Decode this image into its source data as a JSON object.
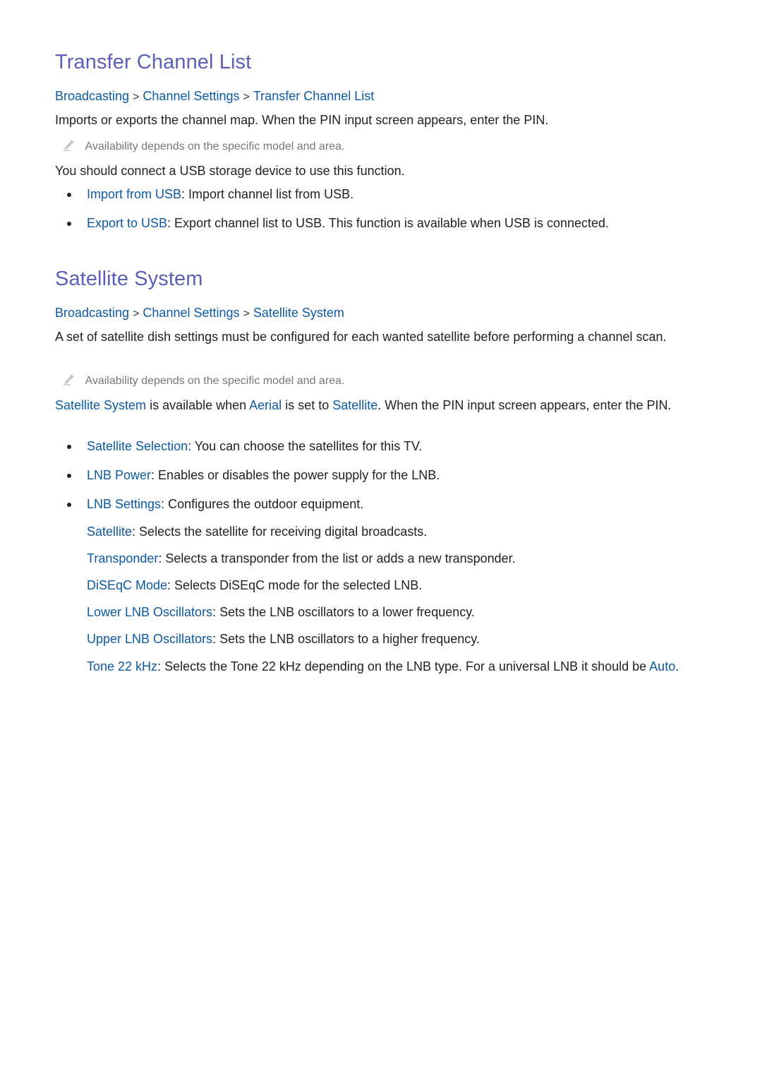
{
  "colors": {
    "heading": "#5b5fb5",
    "link": "#0b5aa2",
    "text": "#222222",
    "note": "#777777"
  },
  "sections": [
    {
      "title": "Transfer Channel List",
      "breadcrumb": [
        "Broadcasting",
        "Channel Settings",
        "Transfer Channel List"
      ],
      "breadcrumb_separator": ">",
      "description": "Imports or exports the channel map. When the PIN input screen appears, enter the PIN.",
      "note": "Availability depends on the specific model and area.",
      "note_icon": "pencil-icon",
      "requirement": "You should connect a USB storage device to use this function.",
      "items": [
        {
          "term": "Import from USB",
          "text": ": Import channel list from USB."
        },
        {
          "term": "Export to USB",
          "text": ": Export channel list to USB. This function is available when USB is connected."
        }
      ]
    },
    {
      "title": "Satellite System",
      "breadcrumb": [
        "Broadcasting",
        "Channel Settings",
        "Satellite System"
      ],
      "breadcrumb_separator": ">",
      "description": "A set of satellite dish settings must be configured for each wanted satellite before performing a channel scan.",
      "note": "Availability depends on the specific model and area.",
      "note_icon": "pencil-icon",
      "availability": {
        "term1": "Satellite System",
        "text1": " is available when ",
        "term2": "Aerial",
        "text2": " is set to ",
        "term3": "Satellite",
        "text3": ". When the PIN input screen appears, enter the PIN."
      },
      "items": [
        {
          "term": "Satellite Selection",
          "text": ": You can choose the satellites for this TV."
        },
        {
          "term": "LNB Power",
          "text": ": Enables or disables the power supply for the LNB."
        },
        {
          "term": "LNB Settings",
          "text": ": Configures the outdoor equipment."
        }
      ],
      "sub_items": [
        {
          "term": "Satellite",
          "text": ": Selects the satellite for receiving digital broadcasts."
        },
        {
          "term": "Transponder",
          "text": ": Selects a transponder from the list or adds a new transponder."
        },
        {
          "term": "DiSEqC Mode",
          "text": ": Selects DiSEqC mode for the selected LNB."
        },
        {
          "term": "Lower LNB Oscillators",
          "text": ": Sets the LNB oscillators to a lower frequency."
        },
        {
          "term": "Upper LNB Oscillators",
          "text": ": Sets the LNB oscillators to a higher frequency."
        },
        {
          "term": "Tone 22 kHz",
          "text": ": Selects the Tone 22 kHz depending on the LNB type. For a universal LNB it should be ",
          "term_end": "Auto",
          "text_end": "."
        }
      ]
    }
  ]
}
